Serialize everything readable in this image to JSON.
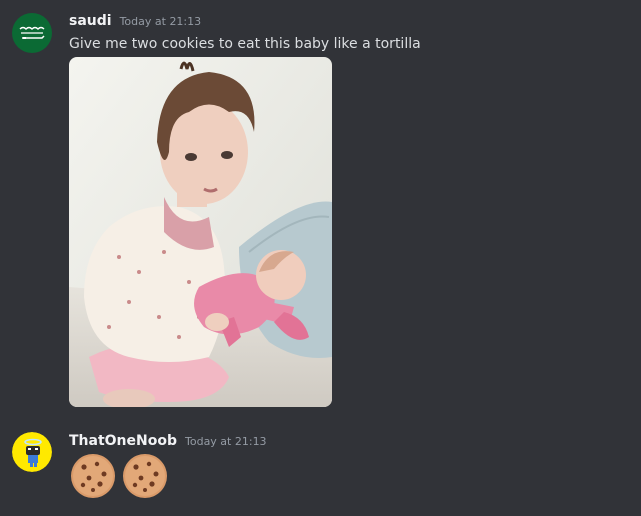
{
  "messages": [
    {
      "username": "saudi",
      "timestamp": "Today at 21:13",
      "content": "Give me two cookies to eat this baby like a tortilla",
      "avatar_icon": "saudi-flag-icon",
      "attachment": "image-attachment"
    },
    {
      "username": "ThatOneNoob",
      "timestamp": "Today at 21:13",
      "avatar_icon": "cartoon-avatar-icon",
      "emojis": [
        "cookie-icon",
        "cookie-icon"
      ]
    }
  ],
  "colors": {
    "background": "#313338",
    "username": "#f2f3f5",
    "timestamp": "#949ba4",
    "text": "#dbdee1"
  }
}
